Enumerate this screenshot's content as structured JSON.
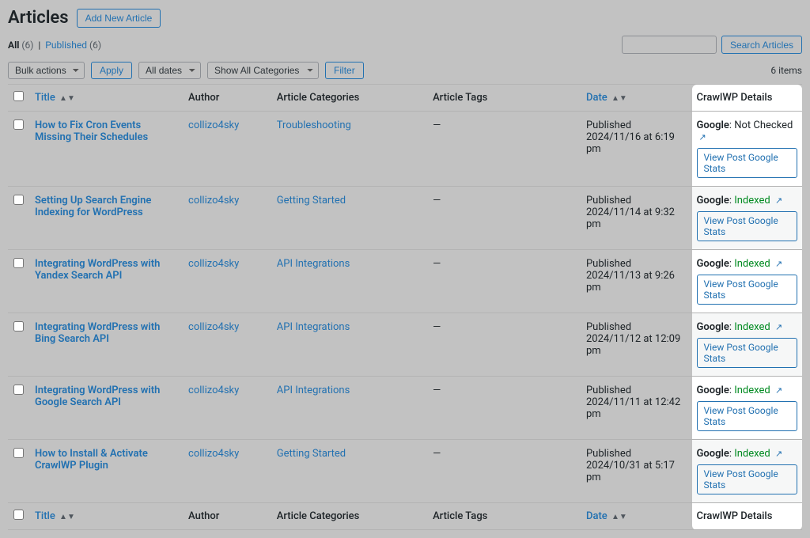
{
  "page": {
    "title": "Articles",
    "add_button": "Add New Article",
    "items_count": "6 items"
  },
  "status": {
    "all_label": "All",
    "all_count": "(6)",
    "published_label": "Published",
    "published_count": "(6)"
  },
  "search": {
    "button": "Search Articles",
    "placeholder": ""
  },
  "filters": {
    "bulk": "Bulk actions",
    "apply": "Apply",
    "dates": "All dates",
    "categories": "Show All Categories",
    "filter": "Filter"
  },
  "columns": {
    "title": "Title",
    "author": "Author",
    "categories": "Article Categories",
    "tags": "Article Tags",
    "date": "Date",
    "crawl": "CrawlWP Details"
  },
  "crawl": {
    "google_label": "Google",
    "stats_button": "View Post Google Stats"
  },
  "rows": [
    {
      "title": "How to Fix Cron Events Missing Their Schedules",
      "author": "collizo4sky",
      "category": "Troubleshooting",
      "tags": "—",
      "status": "Published",
      "date": "2024/11/16 at 6:19 pm",
      "google_status": "Not Checked",
      "google_class": "not-checked"
    },
    {
      "title": "Setting Up Search Engine Indexing for WordPress",
      "author": "collizo4sky",
      "category": "Getting Started",
      "tags": "—",
      "status": "Published",
      "date": "2024/11/14 at 9:32 pm",
      "google_status": "Indexed",
      "google_class": "indexed"
    },
    {
      "title": "Integrating WordPress with Yandex Search API",
      "author": "collizo4sky",
      "category": "API Integrations",
      "tags": "—",
      "status": "Published",
      "date": "2024/11/13 at 9:26 pm",
      "google_status": "Indexed",
      "google_class": "indexed"
    },
    {
      "title": "Integrating WordPress with Bing Search API",
      "author": "collizo4sky",
      "category": "API Integrations",
      "tags": "—",
      "status": "Published",
      "date": "2024/11/12 at 12:09 pm",
      "google_status": "Indexed",
      "google_class": "indexed"
    },
    {
      "title": "Integrating WordPress with Google Search API",
      "author": "collizo4sky",
      "category": "API Integrations",
      "tags": "—",
      "status": "Published",
      "date": "2024/11/11 at 12:42 pm",
      "google_status": "Indexed",
      "google_class": "indexed"
    },
    {
      "title": "How to Install & Activate CrawlWP Plugin",
      "author": "collizo4sky",
      "category": "Getting Started",
      "tags": "—",
      "status": "Published",
      "date": "2024/10/31 at 5:17 pm",
      "google_status": "Indexed",
      "google_class": "indexed"
    }
  ]
}
